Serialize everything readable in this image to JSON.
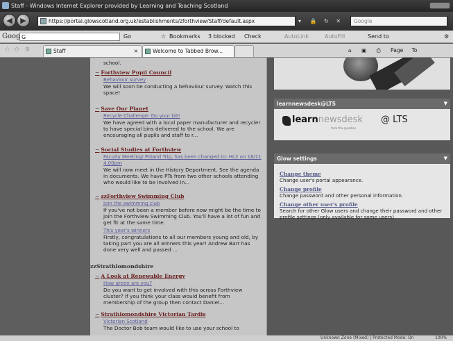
{
  "window": {
    "title": "Staff - Windows Internet Explorer provided by Learning and Teaching Scotland"
  },
  "address_bar": {
    "url": "https://portal.glowscotland.org.uk/establishments/zforthview/Staff/default.aspx",
    "search_placeholder": "Google"
  },
  "google_toolbar": {
    "logo": "Google",
    "search_label": "G",
    "go_label": "Go",
    "bookmarks_label": "Bookmarks",
    "blocked_label": "3 blocked",
    "check_label": "Check",
    "autolink_label": "AutoLink",
    "autofill_label": "AutoFill",
    "sendto_label": "Send to"
  },
  "tabs": [
    {
      "label": "Staff"
    },
    {
      "label": "Welcome to Tabbed Brow..."
    }
  ],
  "tab_tools": {
    "page_label": "Page",
    "tools_label": "To"
  },
  "feed": {
    "top_text": "school.",
    "groups": [
      {
        "title": "Forthview Pupil Council",
        "items": [
          {
            "link": "Behaviour survey",
            "body": "We will soon be conducting a behaviour survey. Watch this space!"
          }
        ]
      },
      {
        "title": "Save Our Planet",
        "items": [
          {
            "link": "Recycle Challenge: Do your bit!",
            "body": "We have agreed with a local paper manufacturer and recycler to have special bins delivered to the school. We are encouraging all pupils and staff to r..."
          }
        ]
      },
      {
        "title": "Social Studies at Forthview",
        "items": [
          {
            "link": "Faculty Meeting/ Poland Trip, has been changed to: HL2 on 18/11 4.00pm",
            "body": "We will now meet in the History Department. See the agenda in documents. We have PTs from two other schools attending who would like to be involved in..."
          }
        ]
      },
      {
        "title": "zzForthview Swimming Club",
        "items": [
          {
            "link": "Join the swimming club",
            "body": "If you've not been a member before now might be the time to join the Forthview Swimming Club. You'll have a lot of fun and get fit at the same time."
          },
          {
            "link": "This year's winners",
            "body": "Firstly, congratulations to all our members young and old, by taking part you are all winners this year! Andrew Barr has done very well and passed ..."
          }
        ]
      },
      {
        "section": "zzStrathlomondshire"
      },
      {
        "title": "A Look at Renewable Energy",
        "items": [
          {
            "link": "How green are you?",
            "body": "Do you want to get involved with this across Forthview cluster? If you think your class would benefit from membership of the group then contact Daniel..."
          }
        ]
      },
      {
        "title": "Strathlomondshire Victorian Tardis",
        "items": [
          {
            "link": "Victorian Scotland",
            "body": "The Doctor Bob team would like to use your school to"
          }
        ]
      }
    ]
  },
  "learnnewsdesk": {
    "header": "learnnewsdesk@LTS",
    "brand_bold": "learn",
    "brand_thin": "newsdesk",
    "byline": "from the guardian",
    "lts": "@ LTS"
  },
  "glow_settings": {
    "header": "Glow settings",
    "items": [
      {
        "link": "Change theme",
        "desc": "Change user's portal appearance."
      },
      {
        "link": "Change profile",
        "desc": "Change password and other personal information."
      },
      {
        "link": "Change other user's profile",
        "desc": "Search for other Glow users and change their password and other profile settings (only available for some users)"
      }
    ]
  },
  "status_bar": {
    "zone": "Unknown Zone (Mixed) | Protected Mode: On",
    "zoom": "100%"
  }
}
